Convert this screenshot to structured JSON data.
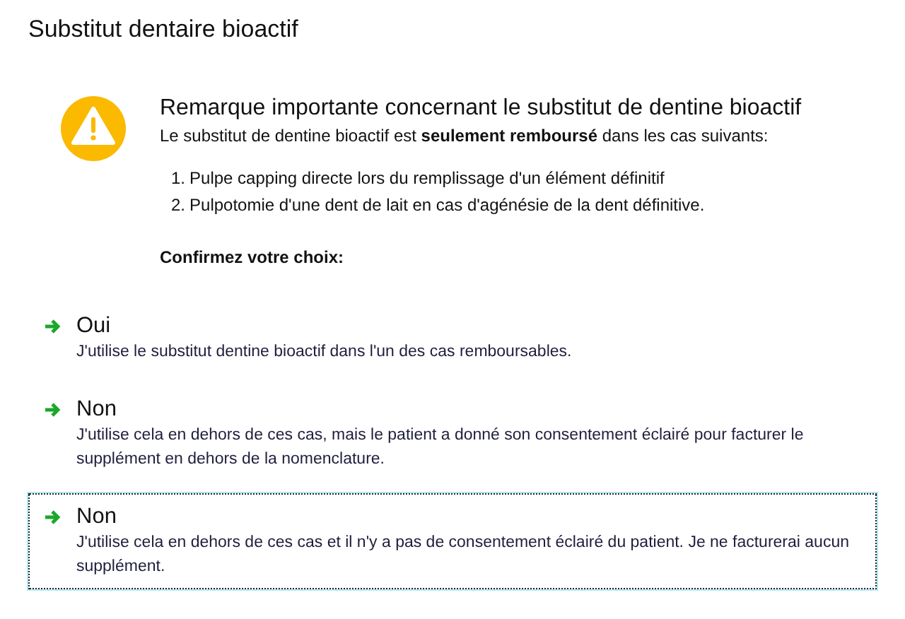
{
  "window": {
    "title": "Substitut dentaire bioactif"
  },
  "notice": {
    "heading": "Remarque importante concernant le substitut de dentine bioactif",
    "text": "Le substitut de dentine bioactif est  **seulement remboursé** dans les cas suivants:",
    "cases": [
      {
        "number": "1.",
        "text": "Pulpe capping directe lors du remplissage d'un élément définitif"
      },
      {
        "number": "2.",
        "text": "Pulpotomie d'une dent de lait en cas d'agénésie de la dent définitive."
      }
    ],
    "prompt": "Confirmez votre choix:"
  },
  "options": [
    {
      "label": "Oui",
      "description": "J'utilise le substitut dentine bioactif dans l'un des cas remboursables.",
      "selected": false
    },
    {
      "label": "Non",
      "description": "J'utilise cela en dehors de ces cas, mais le patient a donné son consentement éclairé pour facturer le supplément en dehors de la nomenclature.",
      "selected": false
    },
    {
      "label": "Non",
      "description": "J'utilise cela en dehors de ces cas et il n'y a pas de consentement éclairé du patient. Je ne facturerai aucun supplément.",
      "selected": true
    }
  ]
}
